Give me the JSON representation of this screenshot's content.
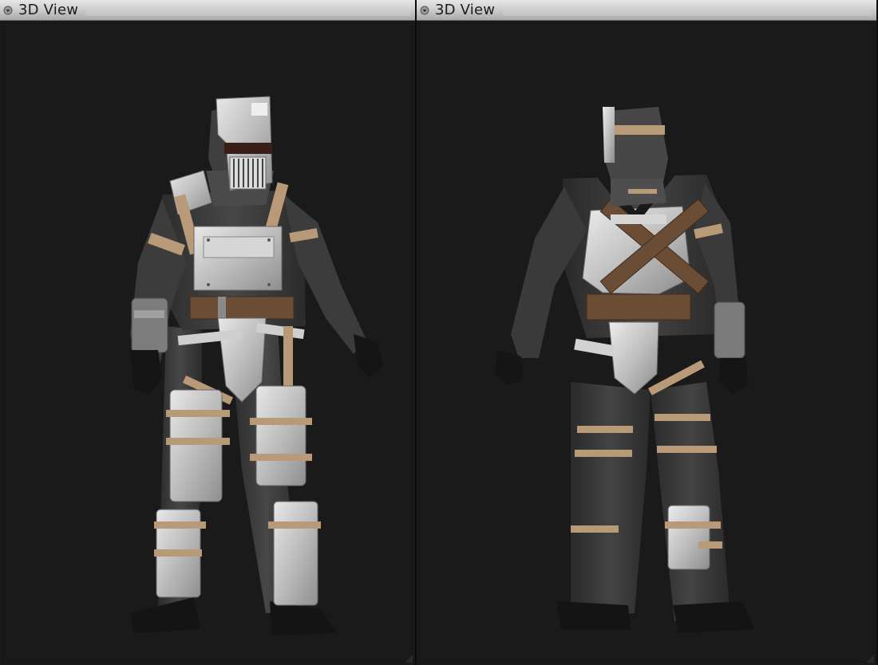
{
  "colors": {
    "titlebar": "#cfcfcf",
    "viewport_background": "#1a1a1a",
    "armor_steel": "#c9c9c9",
    "suit_dark": "#3a3a3a",
    "strap_tan": "#b99a78",
    "belt_brown": "#6b4c35",
    "glove_black": "#151515"
  },
  "panels": [
    {
      "title": "3D View",
      "icon": "collapse-arrow-icon",
      "content": "character-model-front-view"
    },
    {
      "title": "3D View",
      "icon": "collapse-arrow-icon",
      "content": "character-model-back-view"
    }
  ]
}
